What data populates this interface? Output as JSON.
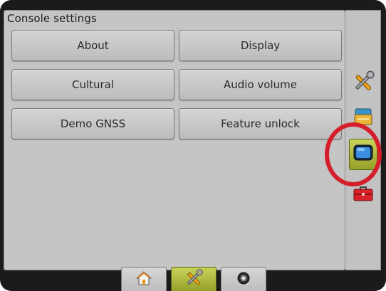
{
  "panel": {
    "title": "Console settings"
  },
  "buttons": [
    {
      "label": "About"
    },
    {
      "label": "Display"
    },
    {
      "label": "Cultural"
    },
    {
      "label": "Audio volume"
    },
    {
      "label": "Demo GNSS"
    },
    {
      "label": "Feature unlock"
    }
  ],
  "sidebar": {
    "items": [
      {
        "icon": "tools-icon",
        "active": false
      },
      {
        "icon": "system-setup-icon",
        "active": false
      },
      {
        "icon": "console-display-icon",
        "active": true
      },
      {
        "icon": "toolbox-icon",
        "active": false
      }
    ]
  },
  "bottom_tabs": [
    {
      "icon": "home-icon",
      "active": false
    },
    {
      "icon": "tools-icon",
      "active": true
    },
    {
      "icon": "camera-icon",
      "active": false
    }
  ],
  "colors": {
    "accent_active": "#b2bd3f",
    "highlight": "#d51e2b",
    "panel_bg": "#c5c5c5",
    "frame": "#1b1b1b"
  }
}
